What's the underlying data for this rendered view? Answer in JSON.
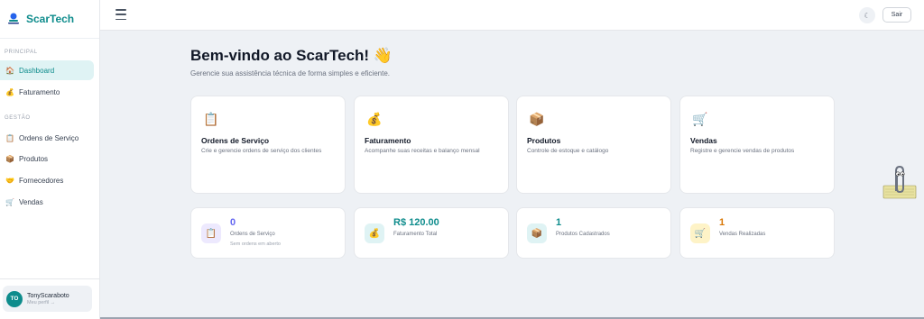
{
  "brand": {
    "name": "ScarTech"
  },
  "sidebar": {
    "sections": [
      {
        "label": "PRINCIPAL"
      },
      {
        "label": "GESTÃO"
      }
    ],
    "items": [
      {
        "label": "Dashboard",
        "icon": "building-icon"
      },
      {
        "label": "Faturamento",
        "icon": "money-bag-icon"
      },
      {
        "label": "Ordens de Serviço",
        "icon": "clipboard-icon"
      },
      {
        "label": "Produtos",
        "icon": "package-icon"
      },
      {
        "label": "Fornecedores",
        "icon": "handshake-icon"
      },
      {
        "label": "Vendas",
        "icon": "cart-icon"
      }
    ],
    "user": {
      "initials": "TO",
      "name": "TonyScaraboto",
      "sub": "Meu perfil →"
    }
  },
  "topbar": {
    "logout_label": "Sair",
    "theme_icon": "moon-icon"
  },
  "main": {
    "title": "Bem-vindo ao ScarTech! 👋",
    "subtitle": "Gerencie sua assistência técnica de forma simples e eficiente.",
    "features": [
      {
        "title": "Ordens de Serviço",
        "desc": "Crie e gerencie ordens de serviço dos clientes",
        "icon": "clipboard-icon"
      },
      {
        "title": "Faturamento",
        "desc": "Acompanhe suas receitas e balanço mensal",
        "icon": "money-bag-icon"
      },
      {
        "title": "Produtos",
        "desc": "Controle de estoque e catálogo",
        "icon": "package-icon"
      },
      {
        "title": "Vendas",
        "desc": "Registre e gerencie vendas de produtos",
        "icon": "cart-icon"
      }
    ],
    "stats": [
      {
        "value": "0",
        "label": "Ordens de Serviço",
        "sub": "Sem ordens em aberto",
        "color": "#6366f1",
        "bg": "#ede9fe",
        "icon": "clipboard-icon"
      },
      {
        "value": "R$ 120.00",
        "label": "Faturamento Total",
        "sub": "",
        "color": "#0e8c8c",
        "bg": "#dff3f4",
        "icon": "money-bag-icon"
      },
      {
        "value": "1",
        "label": "Produtos Cadastrados",
        "sub": "",
        "color": "#0e8c8c",
        "bg": "#dff3f4",
        "icon": "package-icon"
      },
      {
        "value": "1",
        "label": "Vendas Realizadas",
        "sub": "",
        "color": "#d97706",
        "bg": "#fef3c7",
        "icon": "cart-icon"
      }
    ]
  },
  "colors": {
    "accent": "#0e8c8c",
    "background": "#eef1f5"
  }
}
